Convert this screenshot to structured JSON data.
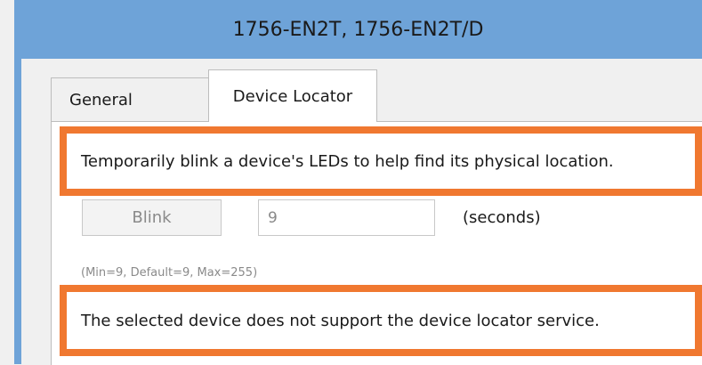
{
  "window": {
    "title": "1756-EN2T, 1756-EN2T/D"
  },
  "tabs": [
    {
      "label": "General"
    },
    {
      "label": "Device Locator"
    }
  ],
  "device_locator": {
    "description": "Temporarily blink a device's LEDs to help find its physical location.",
    "blink_button_label": "Blink",
    "seconds_value": "9",
    "seconds_unit": "(seconds)",
    "range_hint": "(Min=9, Default=9, Max=255)",
    "status_message": "The selected device does not support the device locator service."
  },
  "colors": {
    "title_bar": "#6ea3d8",
    "highlight_border": "#f07830"
  }
}
